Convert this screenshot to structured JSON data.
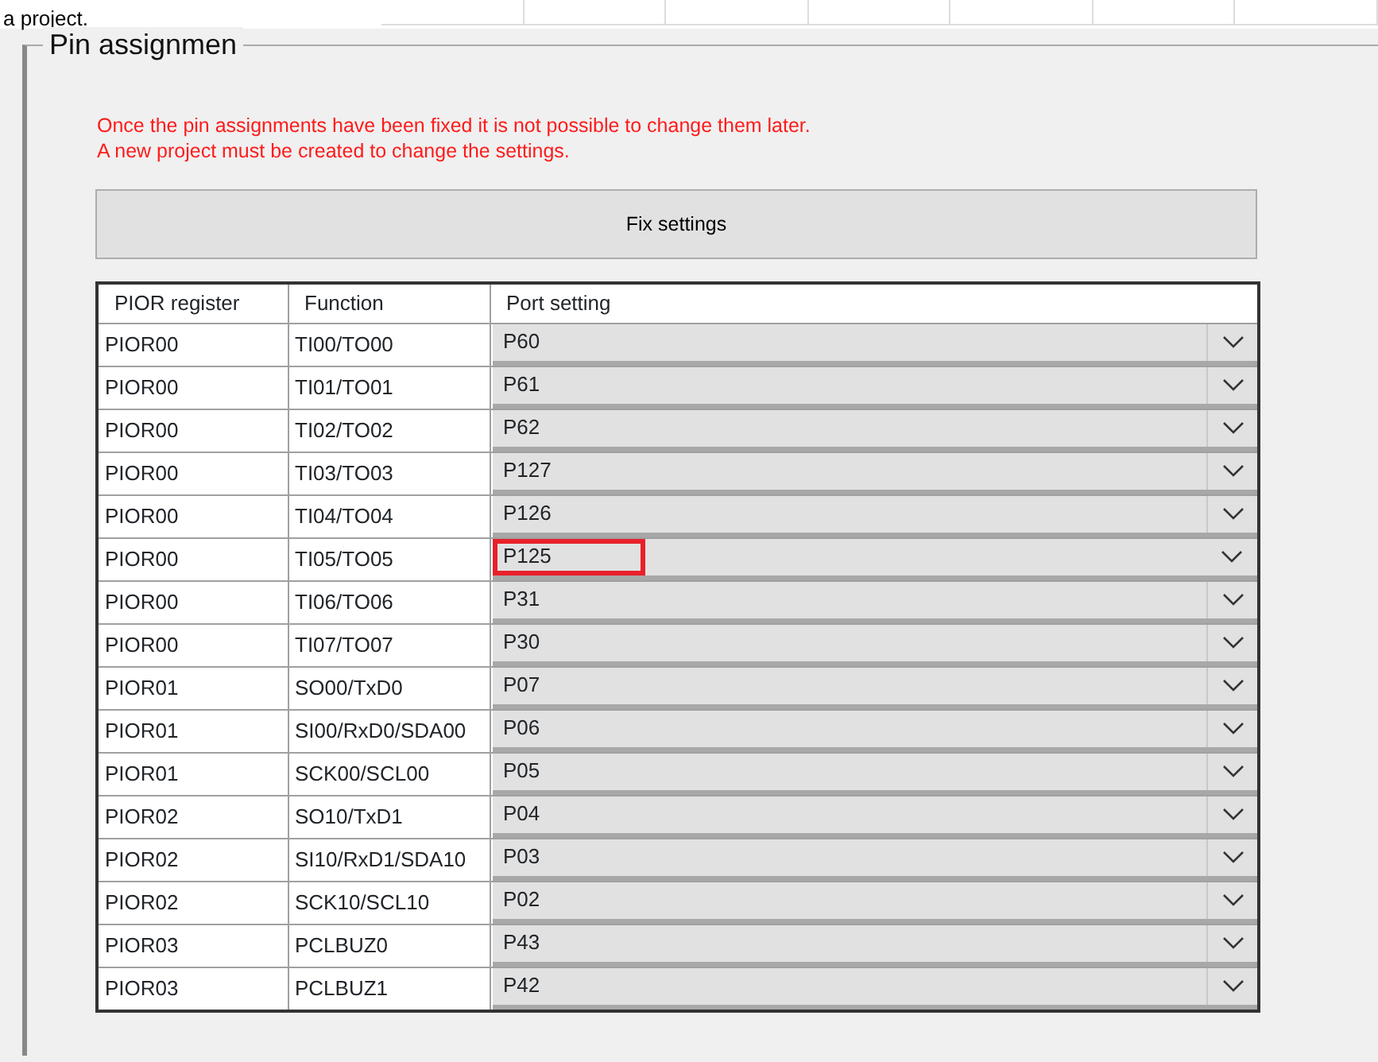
{
  "caption": "a project.",
  "group": {
    "title": "Pin assignmen",
    "warning": [
      "Once the pin assignments have been fixed it is not possible to change them later.",
      "A new project must be created to change the settings."
    ],
    "button": "Fix settings",
    "table": {
      "columns": [
        "PIOR register",
        "Function",
        "Port setting"
      ],
      "rows": [
        {
          "register": "PIOR00",
          "function": "TI00/TO00",
          "port": "P60",
          "highlighted": false
        },
        {
          "register": "PIOR00",
          "function": "TI01/TO01",
          "port": "P61",
          "highlighted": false
        },
        {
          "register": "PIOR00",
          "function": "TI02/TO02",
          "port": "P62",
          "highlighted": false
        },
        {
          "register": "PIOR00",
          "function": "TI03/TO03",
          "port": "P127",
          "highlighted": false
        },
        {
          "register": "PIOR00",
          "function": "TI04/TO04",
          "port": "P126",
          "highlighted": false
        },
        {
          "register": "PIOR00",
          "function": "TI05/TO05",
          "port": "P125",
          "highlighted": true
        },
        {
          "register": "PIOR00",
          "function": "TI06/TO06",
          "port": "P31",
          "highlighted": false
        },
        {
          "register": "PIOR00",
          "function": "TI07/TO07",
          "port": "P30",
          "highlighted": false
        },
        {
          "register": "PIOR01",
          "function": "SO00/TxD0",
          "port": "P07",
          "highlighted": false
        },
        {
          "register": "PIOR01",
          "function": "SI00/RxD0/SDA00",
          "port": "P06",
          "highlighted": false
        },
        {
          "register": "PIOR01",
          "function": "SCK00/SCL00",
          "port": "P05",
          "highlighted": false
        },
        {
          "register": "PIOR02",
          "function": "SO10/TxD1",
          "port": "P04",
          "highlighted": false
        },
        {
          "register": "PIOR02",
          "function": "SI10/RxD1/SDA10",
          "port": "P03",
          "highlighted": false
        },
        {
          "register": "PIOR02",
          "function": "SCK10/SCL10",
          "port": "P02",
          "highlighted": false
        },
        {
          "register": "PIOR03",
          "function": "PCLBUZ0",
          "port": "P43",
          "highlighted": false
        },
        {
          "register": "PIOR03",
          "function": "PCLBUZ1",
          "port": "P42",
          "highlighted": false
        }
      ]
    }
  }
}
